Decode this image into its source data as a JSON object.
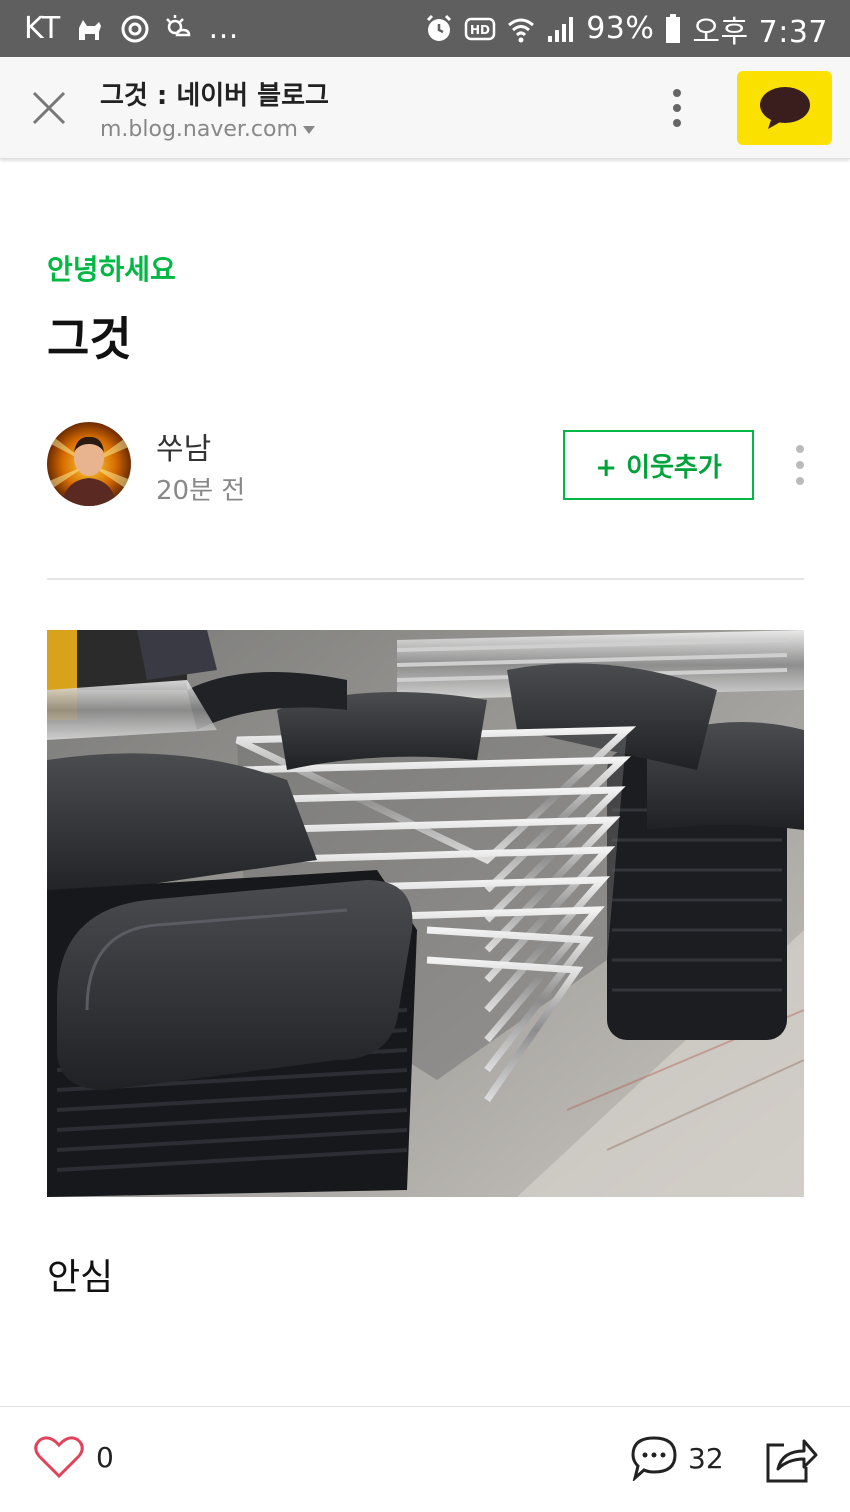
{
  "status_bar": {
    "carrier": "KT",
    "overflow": "...",
    "battery": "93%",
    "time": "오후 7:37",
    "icons": [
      "dog-notification-icon",
      "sync-icon",
      "weather-icon",
      "alarm-icon",
      "hd-icon",
      "wifi-icon",
      "signal-icon",
      "battery-icon"
    ]
  },
  "browser": {
    "title": "그것 : 네이버 블로그",
    "url": "m.blog.naver.com",
    "close_icon": "close-icon",
    "menu_icon": "more-vertical-icon",
    "share_app_icon": "kakaotalk-icon",
    "accent": "#fae100"
  },
  "post": {
    "category": "안녕하세요",
    "title": "그것",
    "author": "쑤남",
    "time": "20분 전",
    "follow_label": "+ 이웃추가",
    "body": "안심",
    "image_subject": "stacked-folding-chairs-photo",
    "accent": "#00b843"
  },
  "actions": {
    "likes": "0",
    "comments": "32",
    "icons": [
      "heart-icon",
      "comment-icon",
      "share-icon"
    ],
    "like_color": "#e0435b"
  }
}
